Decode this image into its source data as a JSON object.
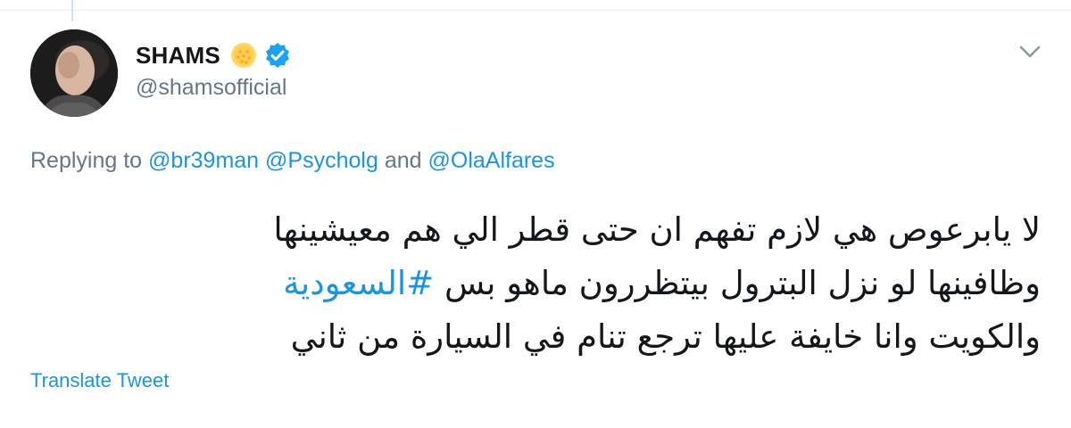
{
  "user": {
    "display_name": "SHAMS",
    "handle": "@shamsofficial",
    "badges": [
      "sun-emoji",
      "verified-badge"
    ],
    "avatar": "profile-photo"
  },
  "reply": {
    "prefix": "Replying to",
    "mention1": "@br39man",
    "mention2": "@Psycholg",
    "connector": "and",
    "mention3": "@OlaAlfares"
  },
  "tweet": {
    "line1": "لا يابرعوص هي لازم تفهم ان حتى قطر الي هم معيشينها",
    "line2_text": "وظافينها لو نزل البترول بيتظررون ماهو بس ",
    "line2_hashtag": "#السعودية",
    "line3": "والكويت وانا خايفة عليها ترجع تنام في السيارة من ثاني"
  },
  "actions": {
    "translate": "Translate Tweet",
    "menu_icon": "chevron-down-icon"
  },
  "colors": {
    "link": "#1b95e0",
    "secondary_text": "#657786",
    "primary_text": "#14171a",
    "verified": "#1da1f2"
  }
}
